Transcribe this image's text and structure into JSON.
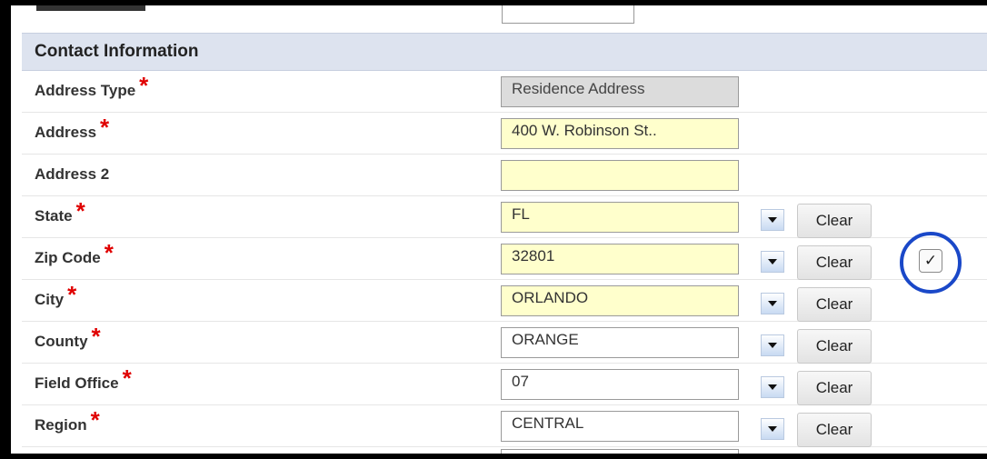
{
  "section": {
    "title": "Contact Information"
  },
  "required_marker": "*",
  "fields": {
    "address_type": {
      "label": "Address Type",
      "value": "Residence Address"
    },
    "address": {
      "label": "Address",
      "value": "400 W. Robinson St.."
    },
    "address2": {
      "label": "Address 2",
      "value": ""
    },
    "state": {
      "label": "State",
      "value": "FL"
    },
    "zip": {
      "label": "Zip Code",
      "value": "32801"
    },
    "city": {
      "label": "City",
      "value": "ORLANDO"
    },
    "county": {
      "label": "County",
      "value": "ORANGE"
    },
    "field_office": {
      "label": "Field Office",
      "value": "07"
    },
    "region": {
      "label": "Region",
      "value": "CENTRAL"
    }
  },
  "buttons": {
    "clear": "Clear"
  },
  "verify": {
    "glyph": "✓"
  },
  "colors": {
    "required": "#e00000",
    "highlight": "#ffffcc",
    "circle": "#1a48c8",
    "header_bg": "#dde3ef"
  }
}
